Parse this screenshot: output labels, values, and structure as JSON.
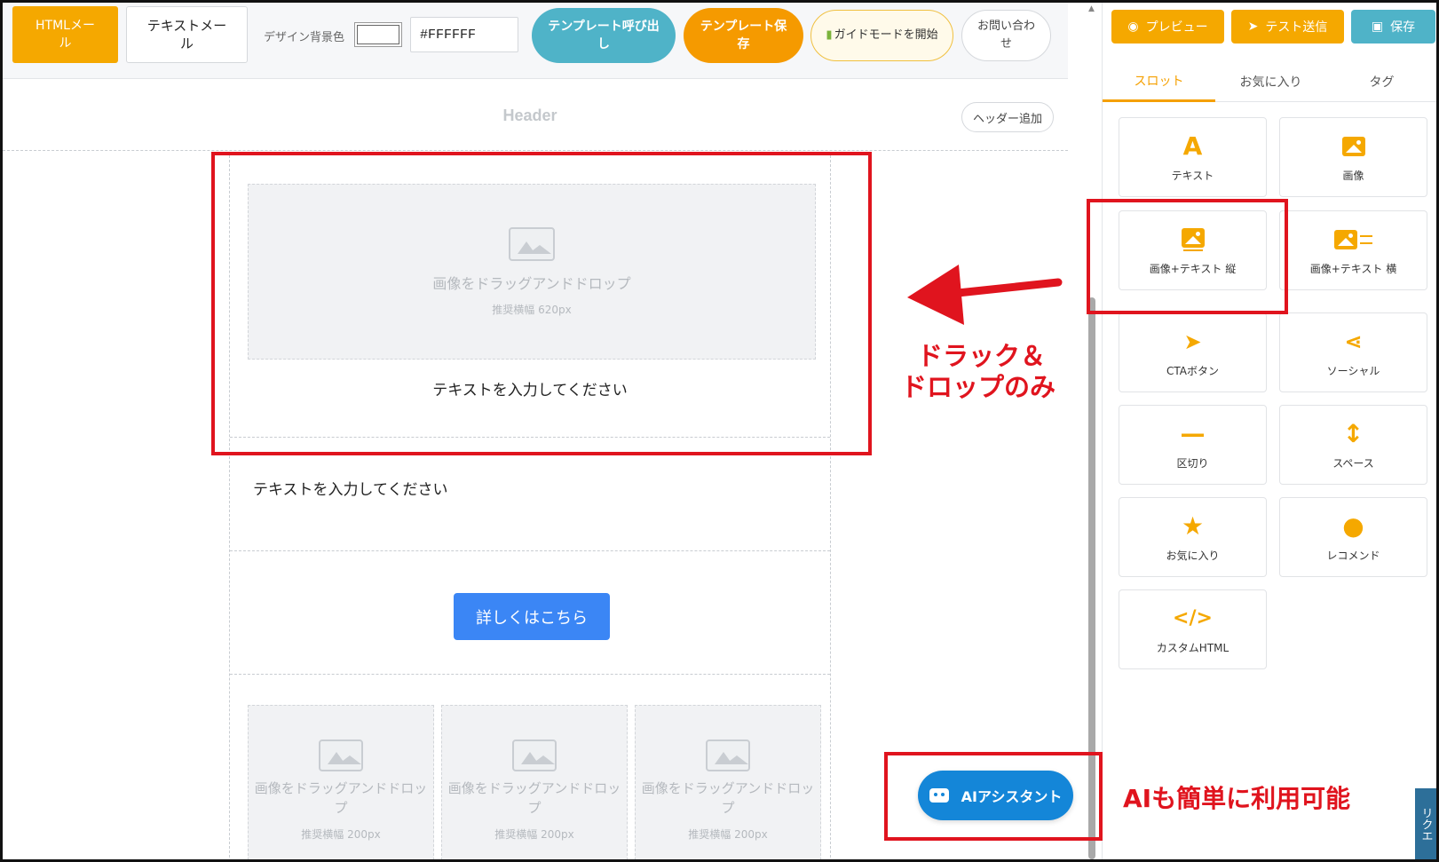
{
  "toolbar": {
    "html_mail": "HTMLメール",
    "text_mail": "テキストメール",
    "bg_label": "デザイン背景色",
    "bg_value": "#FFFFFF",
    "template_call": "テンプレート呼び出し",
    "template_save": "テンプレート保存",
    "guide_mode": "ガイドモードを開始",
    "contact": "お問い合わせ"
  },
  "canvas": {
    "header_label": "Header",
    "header_add": "ヘッダー追加",
    "drop_title": "画像をドラッグアンドドロップ",
    "drop_sub_large": "推奨横幅 620px",
    "text_placeholder": "テキストを入力してください",
    "text_placeholder2": "テキストを入力してください",
    "cta_label": "詳しくはこちら",
    "drop_title_small": "画像をドラッグアンドドロップ",
    "drop_sub_small": "推奨横幅 200px"
  },
  "panel": {
    "preview": "プレビュー",
    "test_send": "テスト送信",
    "save": "保存",
    "tabs": [
      "スロット",
      "お気に入り",
      "タグ"
    ],
    "tiles": [
      {
        "label": "テキスト",
        "icon": "text-icon"
      },
      {
        "label": "画像",
        "icon": "image-icon"
      },
      {
        "label": "画像+テキスト 縦",
        "icon": "image-text-vertical-icon"
      },
      {
        "label": "画像+テキスト 横",
        "icon": "image-text-horizontal-icon"
      },
      {
        "label": "CTAボタン",
        "icon": "cursor-icon"
      },
      {
        "label": "ソーシャル",
        "icon": "share-icon"
      },
      {
        "label": "区切り",
        "icon": "divider-icon"
      },
      {
        "label": "スペース",
        "icon": "space-icon"
      },
      {
        "label": "お気に入り",
        "icon": "star-icon"
      },
      {
        "label": "レコメンド",
        "icon": "lightbulb-icon"
      },
      {
        "label": "カスタムHTML",
        "icon": "code-icon"
      }
    ]
  },
  "ai_assistant": "AIアシスタント",
  "request_tab": "リクエ",
  "annotations": {
    "drag_line1": "ドラック＆",
    "drag_line2": "ドロップのみ",
    "ai_note": "AIも簡単に利用可能"
  },
  "colors": {
    "accent_orange": "#f5a800",
    "accent_teal": "#4fb3c8",
    "cta_blue": "#3b86f5",
    "annotation_red": "#e0141e"
  }
}
